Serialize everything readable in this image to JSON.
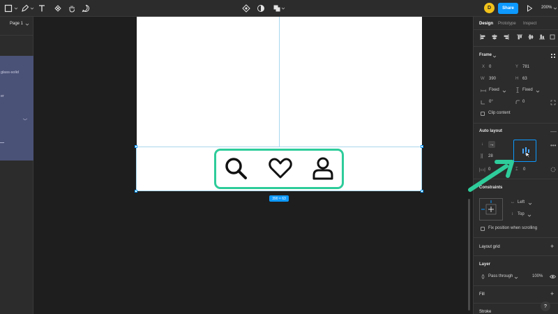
{
  "toolbar": {
    "share_label": "Share",
    "avatar_initial": "D",
    "zoom_label": "200%"
  },
  "left_panel": {
    "page_label": "Page 1",
    "layers": [
      "glass-solid",
      "er"
    ]
  },
  "canvas": {
    "size_badge": "390 × 63"
  },
  "right_panel": {
    "tabs": [
      "Design",
      "Prototype",
      "Inspect"
    ],
    "frame_header": "Frame",
    "x_label": "X",
    "x_value": "0",
    "y_label": "Y",
    "y_value": "781",
    "w_label": "W",
    "w_value": "390",
    "h_label": "H",
    "h_value": "63",
    "h_sizing": "Fixed",
    "v_sizing": "Fixed",
    "rotation": "0°",
    "radius": "0",
    "clip_content": "Clip content",
    "auto_layout_header": "Auto layout",
    "spacing": "28",
    "padding_h": "0",
    "padding_v": "0",
    "constraints_header": "Constraints",
    "constraint_h": "Left",
    "constraint_v": "Top",
    "fix_position": "Fix position when scrolling",
    "layout_grid": "Layout grid",
    "layer_header": "Layer",
    "blend_mode": "Pass through",
    "opacity": "100%",
    "fill_header": "Fill",
    "stroke_header": "Stroke"
  },
  "colors": {
    "accent": "#0d99ff",
    "highlight_frame": "#2ecc9a",
    "canvas_bg": "#1e1e1e",
    "panel_bg": "#2c2c2c"
  }
}
